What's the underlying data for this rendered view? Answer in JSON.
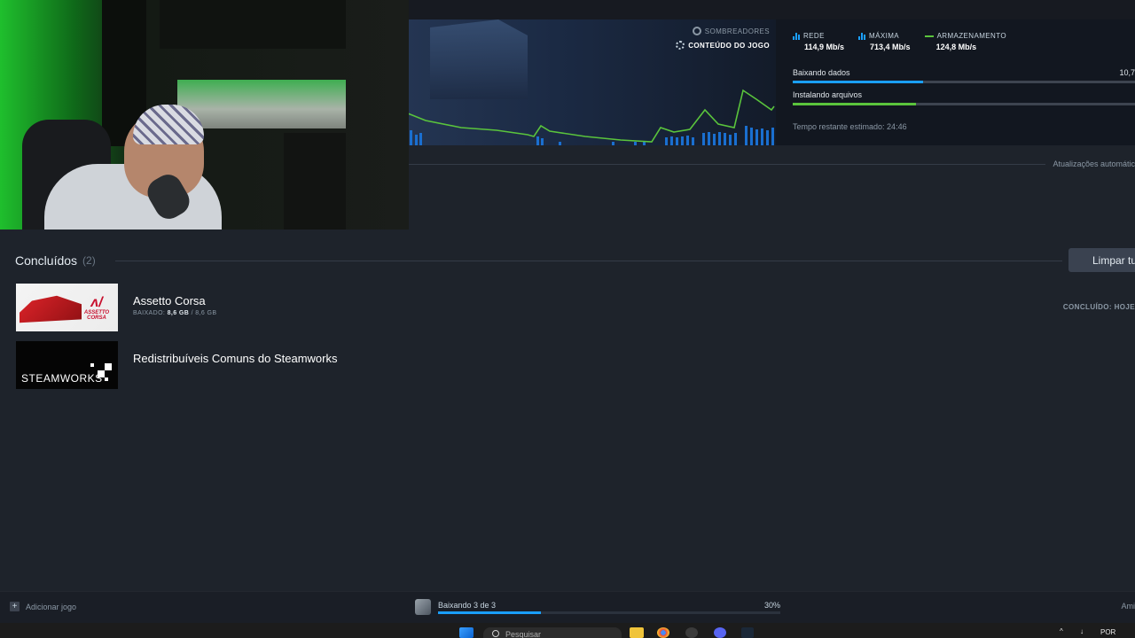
{
  "header": {
    "phase_shaders": "SOMBREADORES",
    "phase_content": "CONTEÚDO DO JOGO",
    "stats": [
      {
        "label": "REDE",
        "value": "114,9 Mb/s",
        "icon": "network-bars-icon"
      },
      {
        "label": "MÁXIMA",
        "value": "713,4 Mb/s",
        "icon": "peak-bars-icon"
      },
      {
        "label": "ARMAZENAMENTO",
        "value": "124,8 Mb/s",
        "icon": "disk-line-icon"
      }
    ],
    "progress": [
      {
        "label": "Baixando dados",
        "value": "10,7",
        "fraction": 0.38,
        "color": "#1a9fff"
      },
      {
        "label": "Instalando arquivos",
        "value": "",
        "fraction": 0.36,
        "color": "#5ac43c"
      }
    ],
    "eta": "Tempo restante estimado: 24:46",
    "auto_updates": "Atualizações automátic"
  },
  "completed": {
    "title": "Concluídos",
    "count": "(2)",
    "clear_button": "Limpar tu",
    "items": [
      {
        "name": "Assetto Corsa",
        "sub_prefix": "BAIXADO:",
        "sub_done": "8,6 GB",
        "sub_total": "/ 8,6 GB",
        "status": "CONCLUÍDO: HOJE",
        "thumb_logo": "ASSETTO CORSA"
      },
      {
        "name": "Redistribuíveis Comuns do Steamworks",
        "thumb_logo": "STEAMWORKS"
      }
    ]
  },
  "bottom": {
    "add_game": "Adicionar jogo",
    "downloading": "Baixando 3 de 3",
    "percent": "30%",
    "percent_fraction": 0.3,
    "friends": "Ami"
  },
  "taskbar": {
    "search": "Pesquisar",
    "lang": "POR"
  },
  "colors": {
    "accent_blue": "#1a9fff",
    "accent_green": "#5ac43c",
    "background": "#1e232b"
  }
}
